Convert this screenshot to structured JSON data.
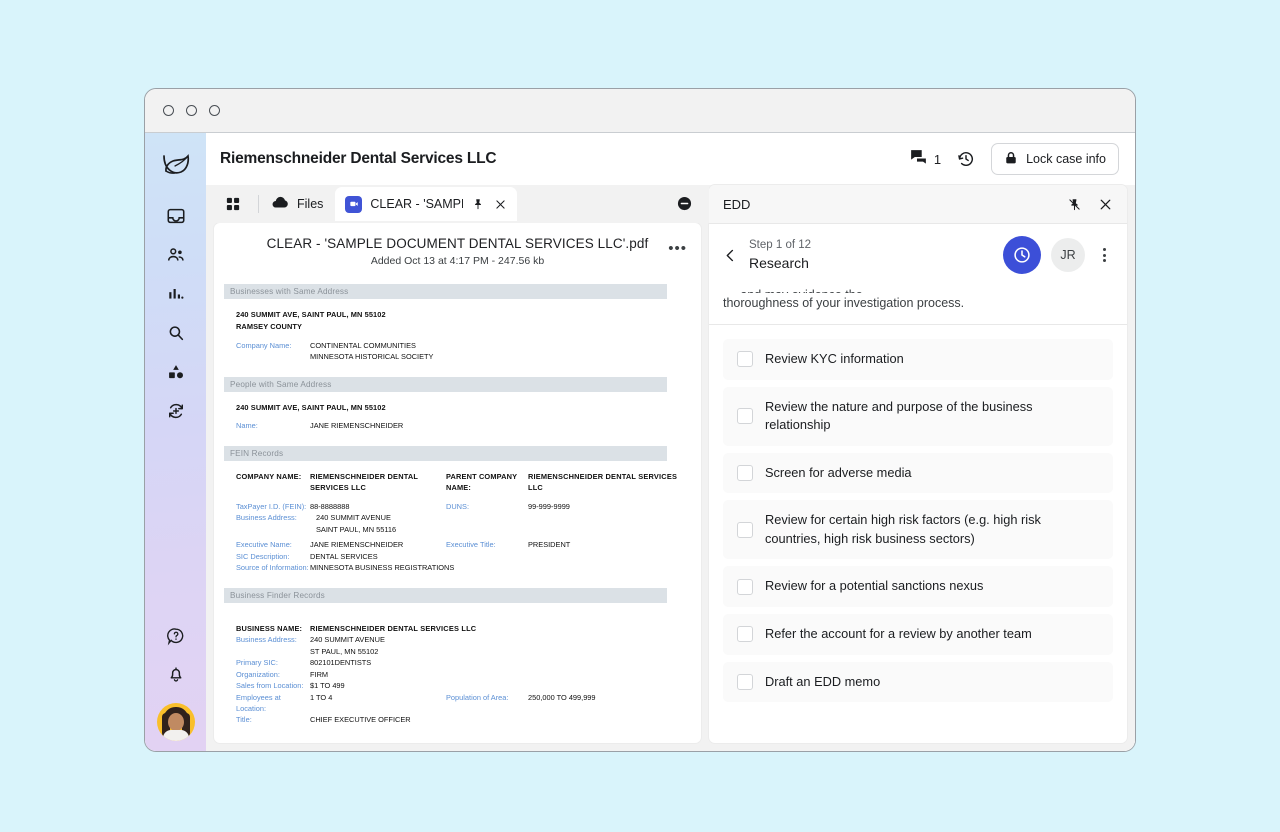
{
  "window": {
    "traffic_dots": [
      "dot-1",
      "dot-2",
      "dot-3"
    ]
  },
  "header": {
    "case_title": "Riemenschneider Dental Services LLC",
    "comment_count": "1",
    "comment_icon": "comment-icon",
    "history_icon": "history-clock-icon",
    "lock_icon": "lock-icon",
    "lock_label": "Lock case info"
  },
  "sidebar": {
    "logo": "bird-leaf-logo",
    "items": [
      {
        "icon": "inbox-icon",
        "name": "sidebar-item-inbox"
      },
      {
        "icon": "people-icon",
        "name": "sidebar-item-people"
      },
      {
        "icon": "bar-chart-icon",
        "name": "sidebar-item-analytics"
      },
      {
        "icon": "search-icon",
        "name": "sidebar-item-search"
      },
      {
        "icon": "shapes-icon",
        "name": "sidebar-item-entities"
      },
      {
        "icon": "refresh-plus-icon",
        "name": "sidebar-item-sync"
      }
    ],
    "bottom_items": [
      {
        "icon": "help-question-icon",
        "name": "sidebar-item-help"
      },
      {
        "icon": "bell-icon",
        "name": "sidebar-item-notifications"
      }
    ],
    "avatar": "user-avatar"
  },
  "tabstrip": {
    "grid_icon": "grid-apps-icon",
    "files_icon": "cloud-icon",
    "files_label": "Files",
    "doc_tab_label": "CLEAR - 'SAMPLE D(",
    "doc_tab_icon": "document-app-icon",
    "pin_icon": "pin-icon",
    "close_icon": "close-icon",
    "collapse_icon": "collapse-circle-icon"
  },
  "document": {
    "title": "CLEAR - 'SAMPLE DOCUMENT DENTAL SERVICES LLC'.pdf",
    "subtitle": "Added Oct 13 at 4:17 PM - 247.56 kb",
    "kebab": "•••",
    "sections": [
      {
        "heading": "Businesses with Same Address",
        "address_lines": [
          "240 SUMMIT AVE, SAINT PAUL, MN 55102",
          "RAMSEY COUNTY"
        ],
        "label_1": "Company Name:",
        "value_1a": "CONTINENTAL COMMUNITIES",
        "value_1b": "MINNESOTA HISTORICAL SOCIETY"
      },
      {
        "heading": "People with Same Address",
        "address_lines": [
          "240 SUMMIT AVE, SAINT PAUL, MN 55102"
        ],
        "label_1": "Name:",
        "value_1a": "JANE RIEMENSCHNEIDER"
      }
    ],
    "fein": {
      "heading": "FEIN Records",
      "company_name_label": "COMPANY NAME:",
      "company_name_value": "RIEMENSCHNEIDER DENTAL SERVICES LLC",
      "parent_company_label": "PARENT COMPANY NAME:",
      "parent_company_value": "RIEMENSCHNEIDER DENTAL SERVICES LLC",
      "taxpayer_label": "TaxPayer I.D. (FEIN):",
      "taxpayer_value": "88-8888888",
      "duns_label": "DUNS:",
      "duns_value": "99-999-9999",
      "business_address_label": "Business Address:",
      "business_address_line1": "240 SUMMIT AVENUE",
      "business_address_line2": "SAINT PAUL, MN 55116",
      "executive_name_label": "Executive Name:",
      "executive_name_value": "JANE RIEMENSCHNEIDER",
      "executive_title_label": "Executive Title:",
      "executive_title_value": "PRESIDENT",
      "sic_label": "SIC Description:",
      "sic_value": "DENTAL SERVICES",
      "source_label": "Source of Information:",
      "source_value": "MINNESOTA BUSINESS REGISTRATIONS"
    },
    "business_finder": {
      "heading": "Business Finder Records",
      "business_name_label": "BUSINESS NAME:",
      "business_name_value": "RIEMENSCHNEIDER DENTAL SERVICES LLC",
      "business_address_label": "Business Address:",
      "business_address_line1": "240 SUMMIT AVENUE",
      "business_address_line2": "ST PAUL, MN 55102",
      "primary_sic_label": "Primary SIC:",
      "primary_sic_value": "802101DENTISTS",
      "organization_label": "Organization:",
      "organization_value": "FIRM",
      "sales_label": "Sales from Location:",
      "sales_value": "$1 TO 499",
      "employees_label": "Employees at Location:",
      "employees_value": "1 TO 4",
      "population_label": "Population of Area:",
      "population_value": "250,000 TO 499,999",
      "title_label": "Title:",
      "title_value": "CHIEF EXECUTIVE OFFICER"
    }
  },
  "edd": {
    "panel_title": "EDD",
    "pin_icon": "pin-icon",
    "close_icon": "close-icon",
    "back_icon": "chevron-left-icon",
    "step_count": "Step 1 of 12",
    "step_name": "Research",
    "clock_icon": "timer-clock-icon",
    "assignee_initials": "JR",
    "kebab_icon": "more-vertical-icon",
    "description_clipped": "..., and may evidence the",
    "description": "thoroughness of your investigation process.",
    "tasks": [
      "Review KYC information",
      "Review the nature and purpose of the business relationship",
      "Screen for adverse media",
      "Review for certain high risk factors (e.g. high risk countries, high risk business sectors)",
      "Review for a potential sanctions nexus",
      "Refer the account for a review by another team",
      "Draft an EDD memo"
    ]
  },
  "colors": {
    "page_bg": "#d9f4fb",
    "accent_blue": "#3c4fd8",
    "tab_blue": "#4054d6",
    "doc_label_blue": "#5b8fd4",
    "section_header_bg": "#dbe1e6",
    "avatar_gold": "#f9bf2b"
  }
}
